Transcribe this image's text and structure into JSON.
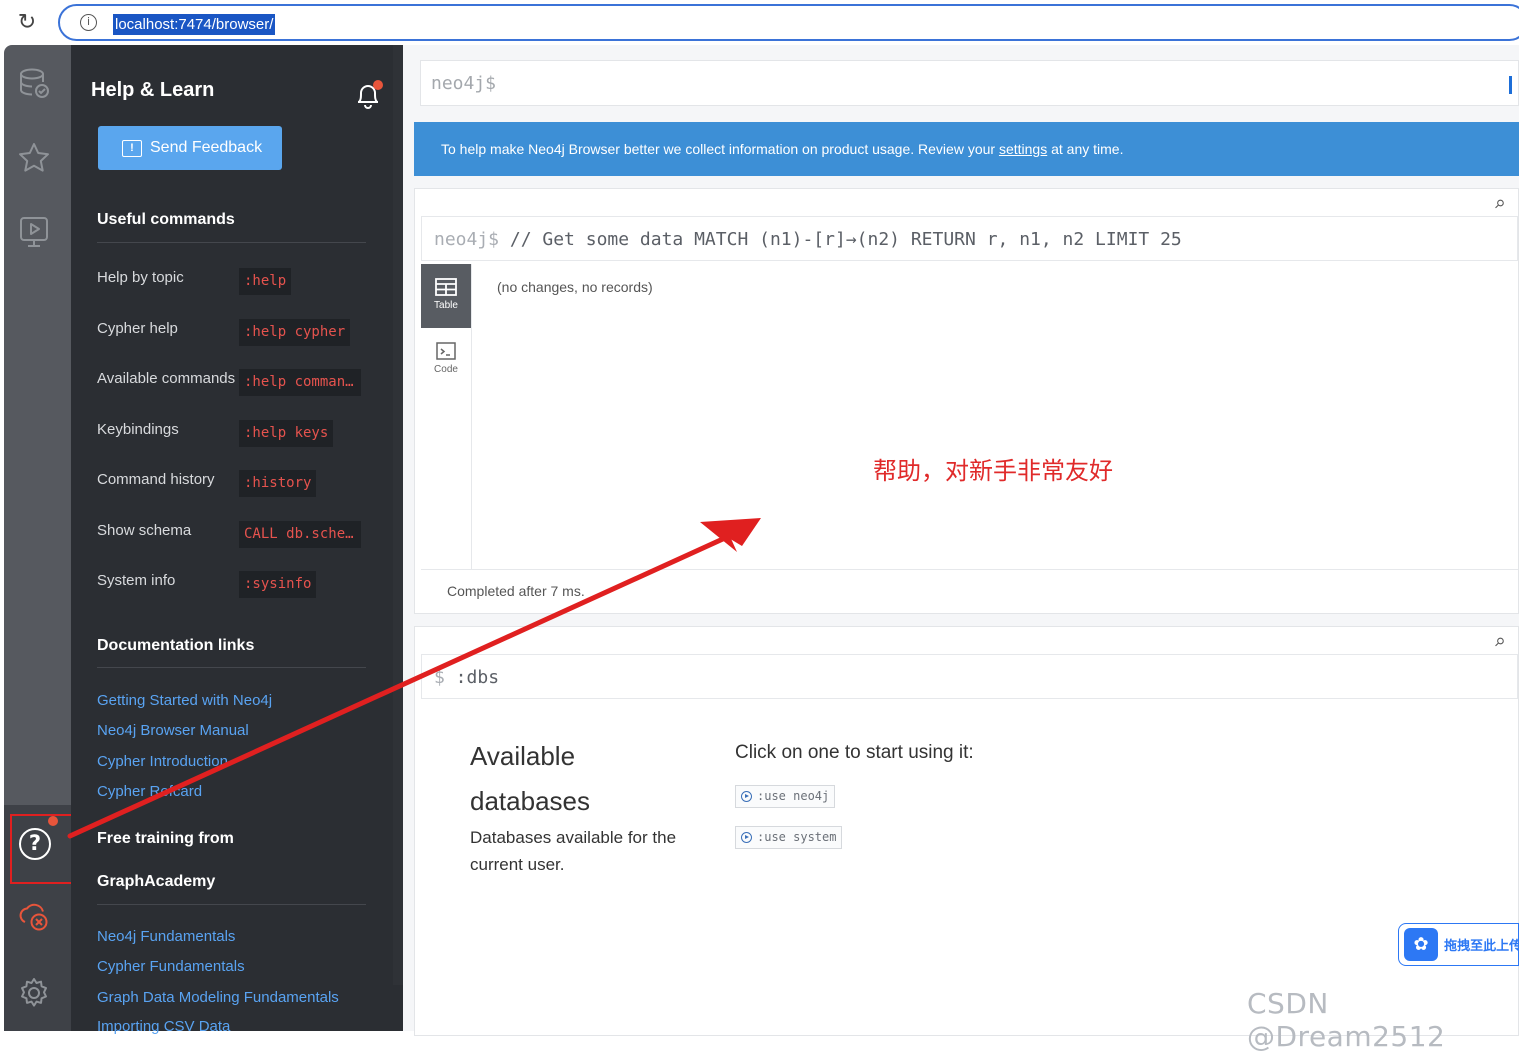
{
  "browser": {
    "url": "localhost:7474/browser/"
  },
  "drawer": {
    "title": "Help & Learn",
    "feedback_label": "Send Feedback",
    "useful_title": "Useful commands",
    "commands": [
      {
        "label": "Help by topic",
        "code": ":help"
      },
      {
        "label": "Cypher help",
        "code": ":help cypher"
      },
      {
        "label": "Available commands",
        "code": ":help comman…"
      },
      {
        "label": "Keybindings",
        "code": ":help keys"
      },
      {
        "label": "Command history",
        "code": ":history"
      },
      {
        "label": "Show schema",
        "code": "CALL db.sche…"
      },
      {
        "label": "System info",
        "code": ":sysinfo"
      }
    ],
    "docs_title": "Documentation links",
    "doc_links": [
      "Getting Started with Neo4j",
      "Neo4j Browser Manual",
      "Cypher Introduction",
      "Cypher Refcard"
    ],
    "training_title_1": "Free training from",
    "training_title_2": "GraphAcademy",
    "training_links": [
      "Neo4j Fundamentals",
      "Cypher Fundamentals",
      "Graph Data Modeling Fundamentals",
      "Importing CSV Data"
    ]
  },
  "editor": {
    "prompt": "neo4j$"
  },
  "banner": {
    "text_before": "To help make Neo4j Browser better we collect information on product usage. Review your ",
    "link": "settings",
    "text_after": " at any time."
  },
  "frame1": {
    "prompt": "neo4j$",
    "query": " // Get some data MATCH (n1)-[r]→(n2) RETURN r, n1, n2 LIMIT 25",
    "tab_table": "Table",
    "tab_code": "Code",
    "result": "(no changes, no records)",
    "status": "Completed after 7 ms."
  },
  "annotation": {
    "text": "帮助，对新手非常友好",
    "color": "#e02a2a"
  },
  "frame2": {
    "prompt": "$",
    "query": " :dbs",
    "title_1": "Available",
    "title_2": "databases",
    "desc": "Databases available for the current user.",
    "hint": "Click on one to start using it:",
    "dbs": [
      ":use neo4j",
      ":use system"
    ]
  },
  "overlay": {
    "baidu_text": "拖拽至此上传",
    "watermark": "CSDN @Dream2512"
  },
  "colors": {
    "rail": "#56595f",
    "drawer": "#2b2e33",
    "accent_blue": "#3d8fd6",
    "code_red": "#e6534e",
    "link_blue": "#59a3f2"
  }
}
